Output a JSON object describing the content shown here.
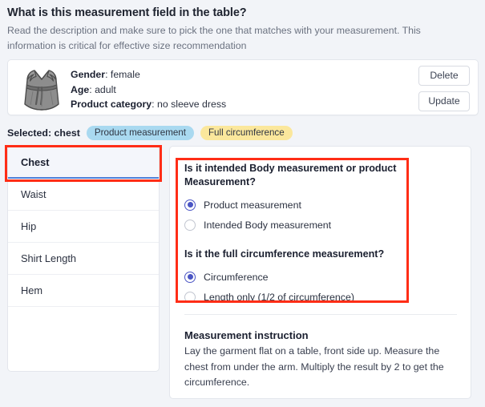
{
  "header": {
    "title": "What is this measurement field in the table?",
    "subtitle": "Read the description and make sure to pick the one that matches with your measurement. This information is critical for effective size recommendation"
  },
  "product_card": {
    "thumbnail_icon": "sleeveless-dress-icon",
    "fields": [
      {
        "label": "Gender",
        "value": "female"
      },
      {
        "label": "Age",
        "value": "adult"
      },
      {
        "label": "Product category",
        "value": "no sleeve dress"
      }
    ],
    "delete_label": "Delete",
    "update_label": "Update"
  },
  "selected": {
    "label": "Selected: chest",
    "badges": [
      {
        "text": "Product measurement",
        "color": "#a9d9f0"
      },
      {
        "text": "Full circumference",
        "color": "#fbe79c"
      }
    ]
  },
  "field_list": {
    "items": [
      {
        "label": "Chest",
        "active": true
      },
      {
        "label": "Waist",
        "active": false
      },
      {
        "label": "Hip",
        "active": false
      },
      {
        "label": "Shirt Length",
        "active": false
      },
      {
        "label": "Hem",
        "active": false
      }
    ]
  },
  "detail": {
    "question1": {
      "title": "Is it intended Body measurement or product Measurement?",
      "options": [
        {
          "label": "Product measurement",
          "checked": true
        },
        {
          "label": "Intended Body measurement",
          "checked": false
        }
      ]
    },
    "question2": {
      "title": "Is it the full circumference measurement?",
      "options": [
        {
          "label": "Circumference",
          "checked": true
        },
        {
          "label": "Length only (1/2 of circumference)",
          "checked": false
        }
      ]
    },
    "instruction": {
      "title": "Measurement instruction",
      "body": "Lay the garment flat on a table, front side up. Measure the chest from under the arm. Multiply the result by 2 to get the circumference."
    }
  },
  "annotations": {
    "color": "#ff2d16",
    "boxes": [
      {
        "name": "chest-list-item-highlight"
      },
      {
        "name": "measurement-questions-highlight"
      }
    ]
  }
}
